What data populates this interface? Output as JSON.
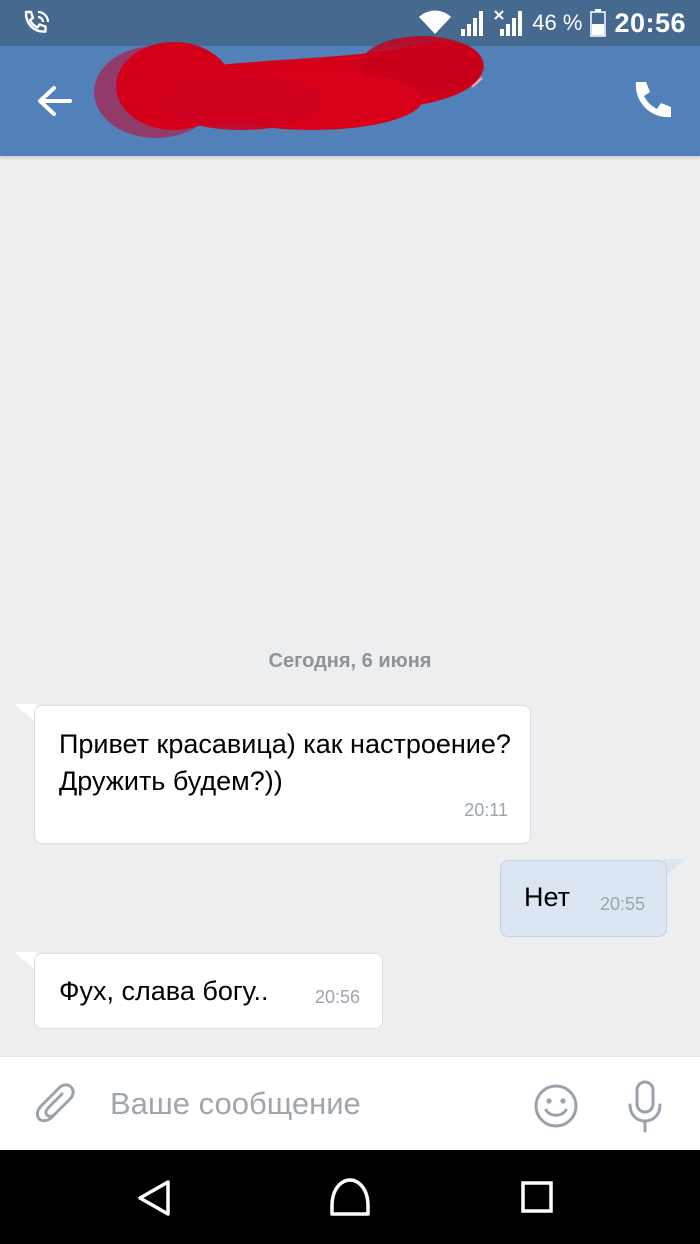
{
  "status_bar": {
    "battery_percent": "46 %",
    "time": "20:56"
  },
  "colors": {
    "header": "#5181b8",
    "status_bar": "#46698f",
    "chat_background": "#edeef0",
    "outgoing_bubble": "#dce6f2",
    "redaction": "#d4001a"
  },
  "header": {
    "contact_name_redacted": true,
    "icons": [
      "back-arrow-icon",
      "chevron-down-icon",
      "phone-icon"
    ]
  },
  "chat": {
    "date_separator": "Сегодня, 6 июня",
    "messages": [
      {
        "direction": "incoming",
        "text": "Привет красавица) как настроение? Дружить будем?))",
        "time": "20:11"
      },
      {
        "direction": "outgoing",
        "text": "Нет",
        "time": "20:55"
      },
      {
        "direction": "incoming",
        "text": "Фух, слава богу..",
        "time": "20:56"
      }
    ]
  },
  "composer": {
    "placeholder": "Ваше сообщение",
    "icons": [
      "paperclip-icon",
      "emoji-icon",
      "microphone-icon"
    ]
  },
  "nav_bar": {
    "icons": [
      "nav-back-icon",
      "nav-home-icon",
      "nav-recents-icon"
    ]
  }
}
